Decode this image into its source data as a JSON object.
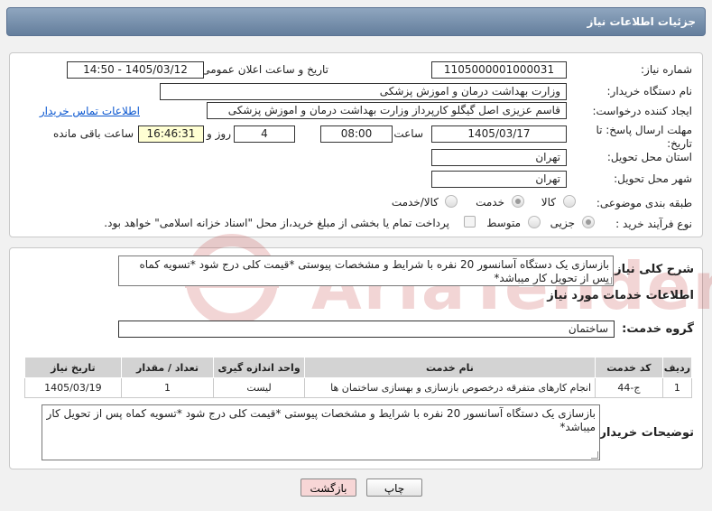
{
  "header": {
    "title": "جزئیات اطلاعات نیاز"
  },
  "form": {
    "need_number_label": "شماره نیاز:",
    "need_number": "1105000001000031",
    "announce_label": "تاریخ و ساعت اعلان عمومی:",
    "announce_value": "1405/03/12 - 14:50",
    "buyer_label": "نام دستگاه خریدار:",
    "buyer_value": "وزارت بهداشت  درمان و اموزش پزشکی",
    "creator_label": "ایجاد کننده درخواست:",
    "creator_value": "قاسم عزیزی اصل گیگلو کارپرداز وزارت بهداشت  درمان و اموزش پزشکی",
    "contact_link": "اطلاعات تماس خریدار",
    "deadline_label": "مهلت ارسال پاسخ: تا تاریخ:",
    "deadline_date": "1405/03/17",
    "time_label": "ساعت",
    "deadline_time": "08:00",
    "days_value": "4",
    "days_label": "روز و",
    "remaining_value": "16:46:31",
    "remaining_label": "ساعت باقی مانده",
    "province_label": "استان محل تحویل:",
    "province_value": "تهران",
    "city_label": "شهر محل تحویل:",
    "city_value": "تهران",
    "category_label": "طبقه بندی موضوعی:",
    "category_options": [
      "کالا",
      "خدمت",
      "کالا/خدمت"
    ],
    "process_label": "نوع فرآیند خرید :",
    "process_options": [
      "جزیی",
      "متوسط"
    ],
    "payment_note": "پرداخت تمام یا بخشی از مبلغ خرید،از محل \"اسناد خزانه اسلامی\" خواهد بود."
  },
  "summary": {
    "label": "شرح کلی نیاز:",
    "text": "بازسازی یک دستگاه آسانسور 20 نفره با شرایط و مشخصات پیوستی *قیمت کلی درج شود *تسویه کماه پس از تحویل کار میباشد*"
  },
  "services": {
    "section_title": "اطلاعات خدمات مورد نیاز",
    "group_label": "گروه خدمت:",
    "group_value": "ساختمان",
    "columns": [
      "ردیف",
      "کد خدمت",
      "نام خدمت",
      "واحد اندازه گیری",
      "تعداد / مقدار",
      "تاریخ نیاز"
    ],
    "rows": [
      [
        "1",
        "ج-44",
        "انجام کارهای متفرقه درخصوص بازسازی و بهسازی ساختمان ها",
        "لیست",
        "1",
        "1405/03/19"
      ]
    ]
  },
  "notes": {
    "label": "توضیحات خریدار:",
    "text": "بازسازی یک دستگاه آسانسور 20 نفره با شرایط و مشخصات پیوستی *قیمت کلی درج شود *تسویه کماه پس از تحویل کار میباشد*"
  },
  "buttons": {
    "print": "چاپ",
    "back": "بازگشت"
  },
  "watermark": {
    "text": "AriaTender.net"
  },
  "colors": {
    "accent_header": "#6f89a7",
    "link": "#0b57d0",
    "highlight": "#ffffd3",
    "back_button": "#f7d6d6"
  }
}
